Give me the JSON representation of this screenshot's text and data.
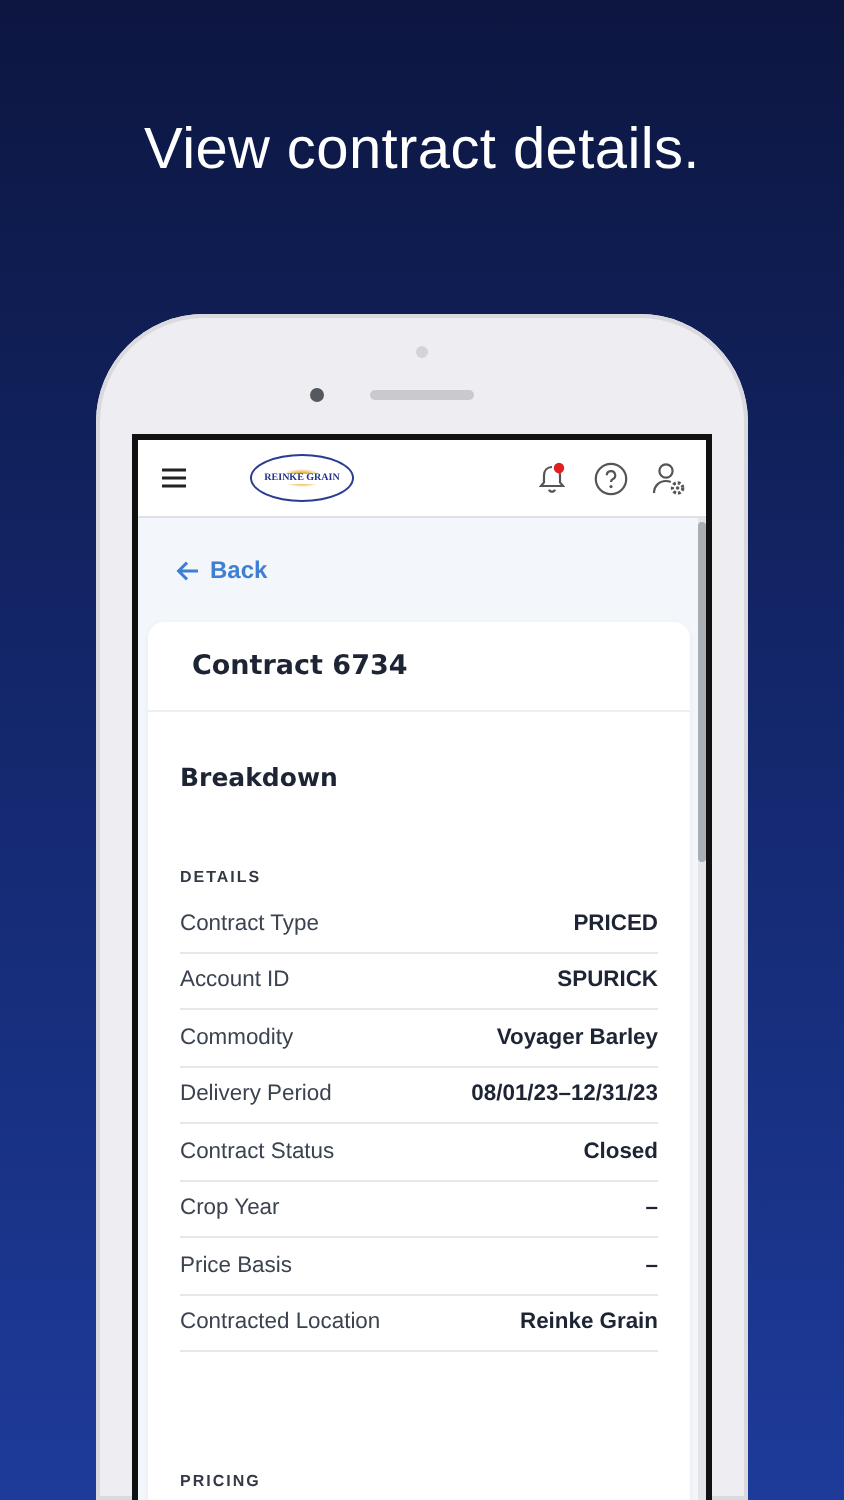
{
  "headline": "View contract details.",
  "header": {
    "logo_text": "REINKE GRAIN",
    "has_unread": true
  },
  "back": "Back",
  "contract": {
    "title": "Contract 6734",
    "section_title": "Breakdown",
    "groups": [
      {
        "heading": "DETAILS",
        "rows": [
          {
            "label": "Contract Type",
            "value": "PRICED"
          },
          {
            "label": "Account ID",
            "value": "SPURICK"
          },
          {
            "label": "Commodity",
            "value": "Voyager Barley"
          },
          {
            "label": "Delivery Period",
            "value": "08/01/23–12/31/23"
          },
          {
            "label": "Contract Status",
            "value": "Closed"
          },
          {
            "label": "Crop Year",
            "value": "–"
          },
          {
            "label": "Price Basis",
            "value": "–"
          },
          {
            "label": "Contracted Location",
            "value": "Reinke Grain"
          }
        ]
      },
      {
        "heading": "PRICING"
      }
    ]
  }
}
